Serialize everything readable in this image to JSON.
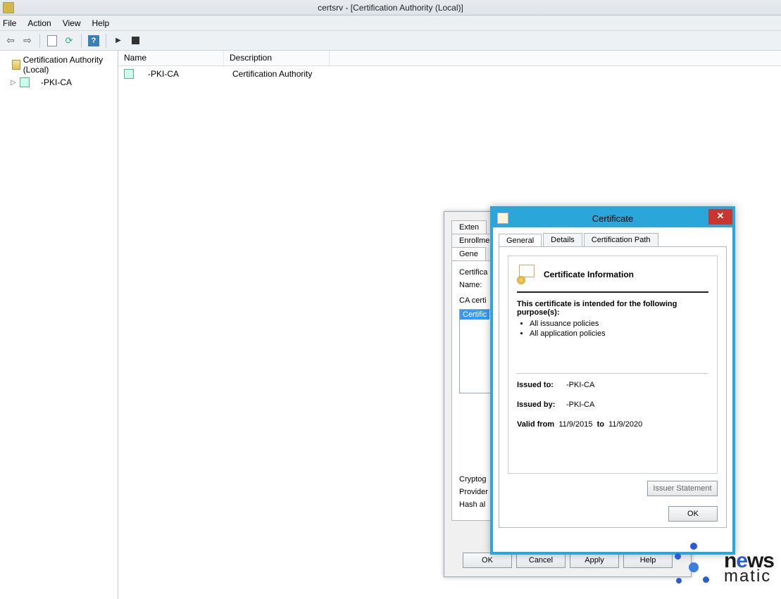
{
  "window": {
    "title": "certsrv - [Certification Authority (Local)]"
  },
  "menu": {
    "file": "File",
    "action": "Action",
    "view": "View",
    "help": "Help"
  },
  "tree": {
    "root": "Certification Authority (Local)",
    "child": "-PKI-CA"
  },
  "list": {
    "columns": {
      "name": "Name",
      "desc": "Description"
    },
    "rows": [
      {
        "name": "-PKI-CA",
        "desc": "Certification Authority"
      }
    ]
  },
  "props": {
    "tabs": {
      "ext": "Exten",
      "enroll": "Enrollment",
      "gen": "Gene"
    },
    "lab_name": "Certifica",
    "lab_name2": "Name:",
    "lab_cacerts": "CA certi",
    "list_item": "Certific",
    "lab_crypto": "Cryptog",
    "lab_provider": "Provider",
    "lab_hash": "Hash al",
    "btn_ok": "OK",
    "btn_cancel": "Cancel",
    "btn_apply": "Apply",
    "btn_help": "Help"
  },
  "cert": {
    "title": "Certificate",
    "tabs": {
      "general": "General",
      "details": "Details",
      "path": "Certification Path"
    },
    "heading": "Certificate Information",
    "purpose_head": "This certificate is intended for the following purpose(s):",
    "purposes": [
      "All issuance policies",
      "All application policies"
    ],
    "issued_to_label": "Issued to:",
    "issued_to": "-PKI-CA",
    "issued_by_label": "Issued by:",
    "issued_by": "-PKI-CA",
    "valid_from_label": "Valid from",
    "valid_from": "11/9/2015",
    "valid_to_label": "to",
    "valid_to": "11/9/2020",
    "issuer_btn": "Issuer Statement",
    "btn_ok": "OK"
  },
  "watermark": {
    "line1a": "n",
    "line1o": "e",
    "line1b": "ws",
    "line2": "matic"
  }
}
